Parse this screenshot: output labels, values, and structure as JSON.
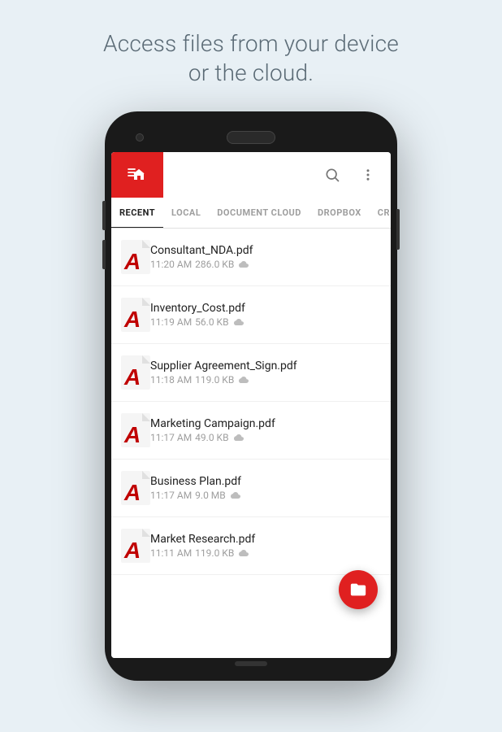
{
  "headline": {
    "line1": "Access files from your device",
    "line2": "or the cloud."
  },
  "app": {
    "tabs": [
      {
        "id": "recent",
        "label": "RECENT",
        "active": true
      },
      {
        "id": "local",
        "label": "LOCAL",
        "active": false
      },
      {
        "id": "document_cloud",
        "label": "DOCUMENT CLOUD",
        "active": false
      },
      {
        "id": "dropbox",
        "label": "DROPBOX",
        "active": false
      },
      {
        "id": "cr",
        "label": "CR",
        "active": false
      }
    ],
    "files": [
      {
        "name": "Consultant_NDA.pdf",
        "time": "11:20 AM",
        "size": "286.0 KB",
        "cloud": true
      },
      {
        "name": "Inventory_Cost.pdf",
        "time": "11:19 AM",
        "size": "56.0 KB",
        "cloud": true
      },
      {
        "name": "Supplier Agreement_Sign.pdf",
        "time": "11:18 AM",
        "size": "119.0 KB",
        "cloud": true
      },
      {
        "name": "Marketing Campaign.pdf",
        "time": "11:17 AM",
        "size": "49.0 KB",
        "cloud": true
      },
      {
        "name": "Business Plan.pdf",
        "time": "11:17 AM",
        "size": "9.0 MB",
        "cloud": true
      },
      {
        "name": "Market Research.pdf",
        "time": "11:11 AM",
        "size": "119.0 KB",
        "cloud": true
      }
    ],
    "colors": {
      "accent": "#e02020",
      "tab_active": "#212121",
      "tab_inactive": "#9e9e9e"
    }
  }
}
